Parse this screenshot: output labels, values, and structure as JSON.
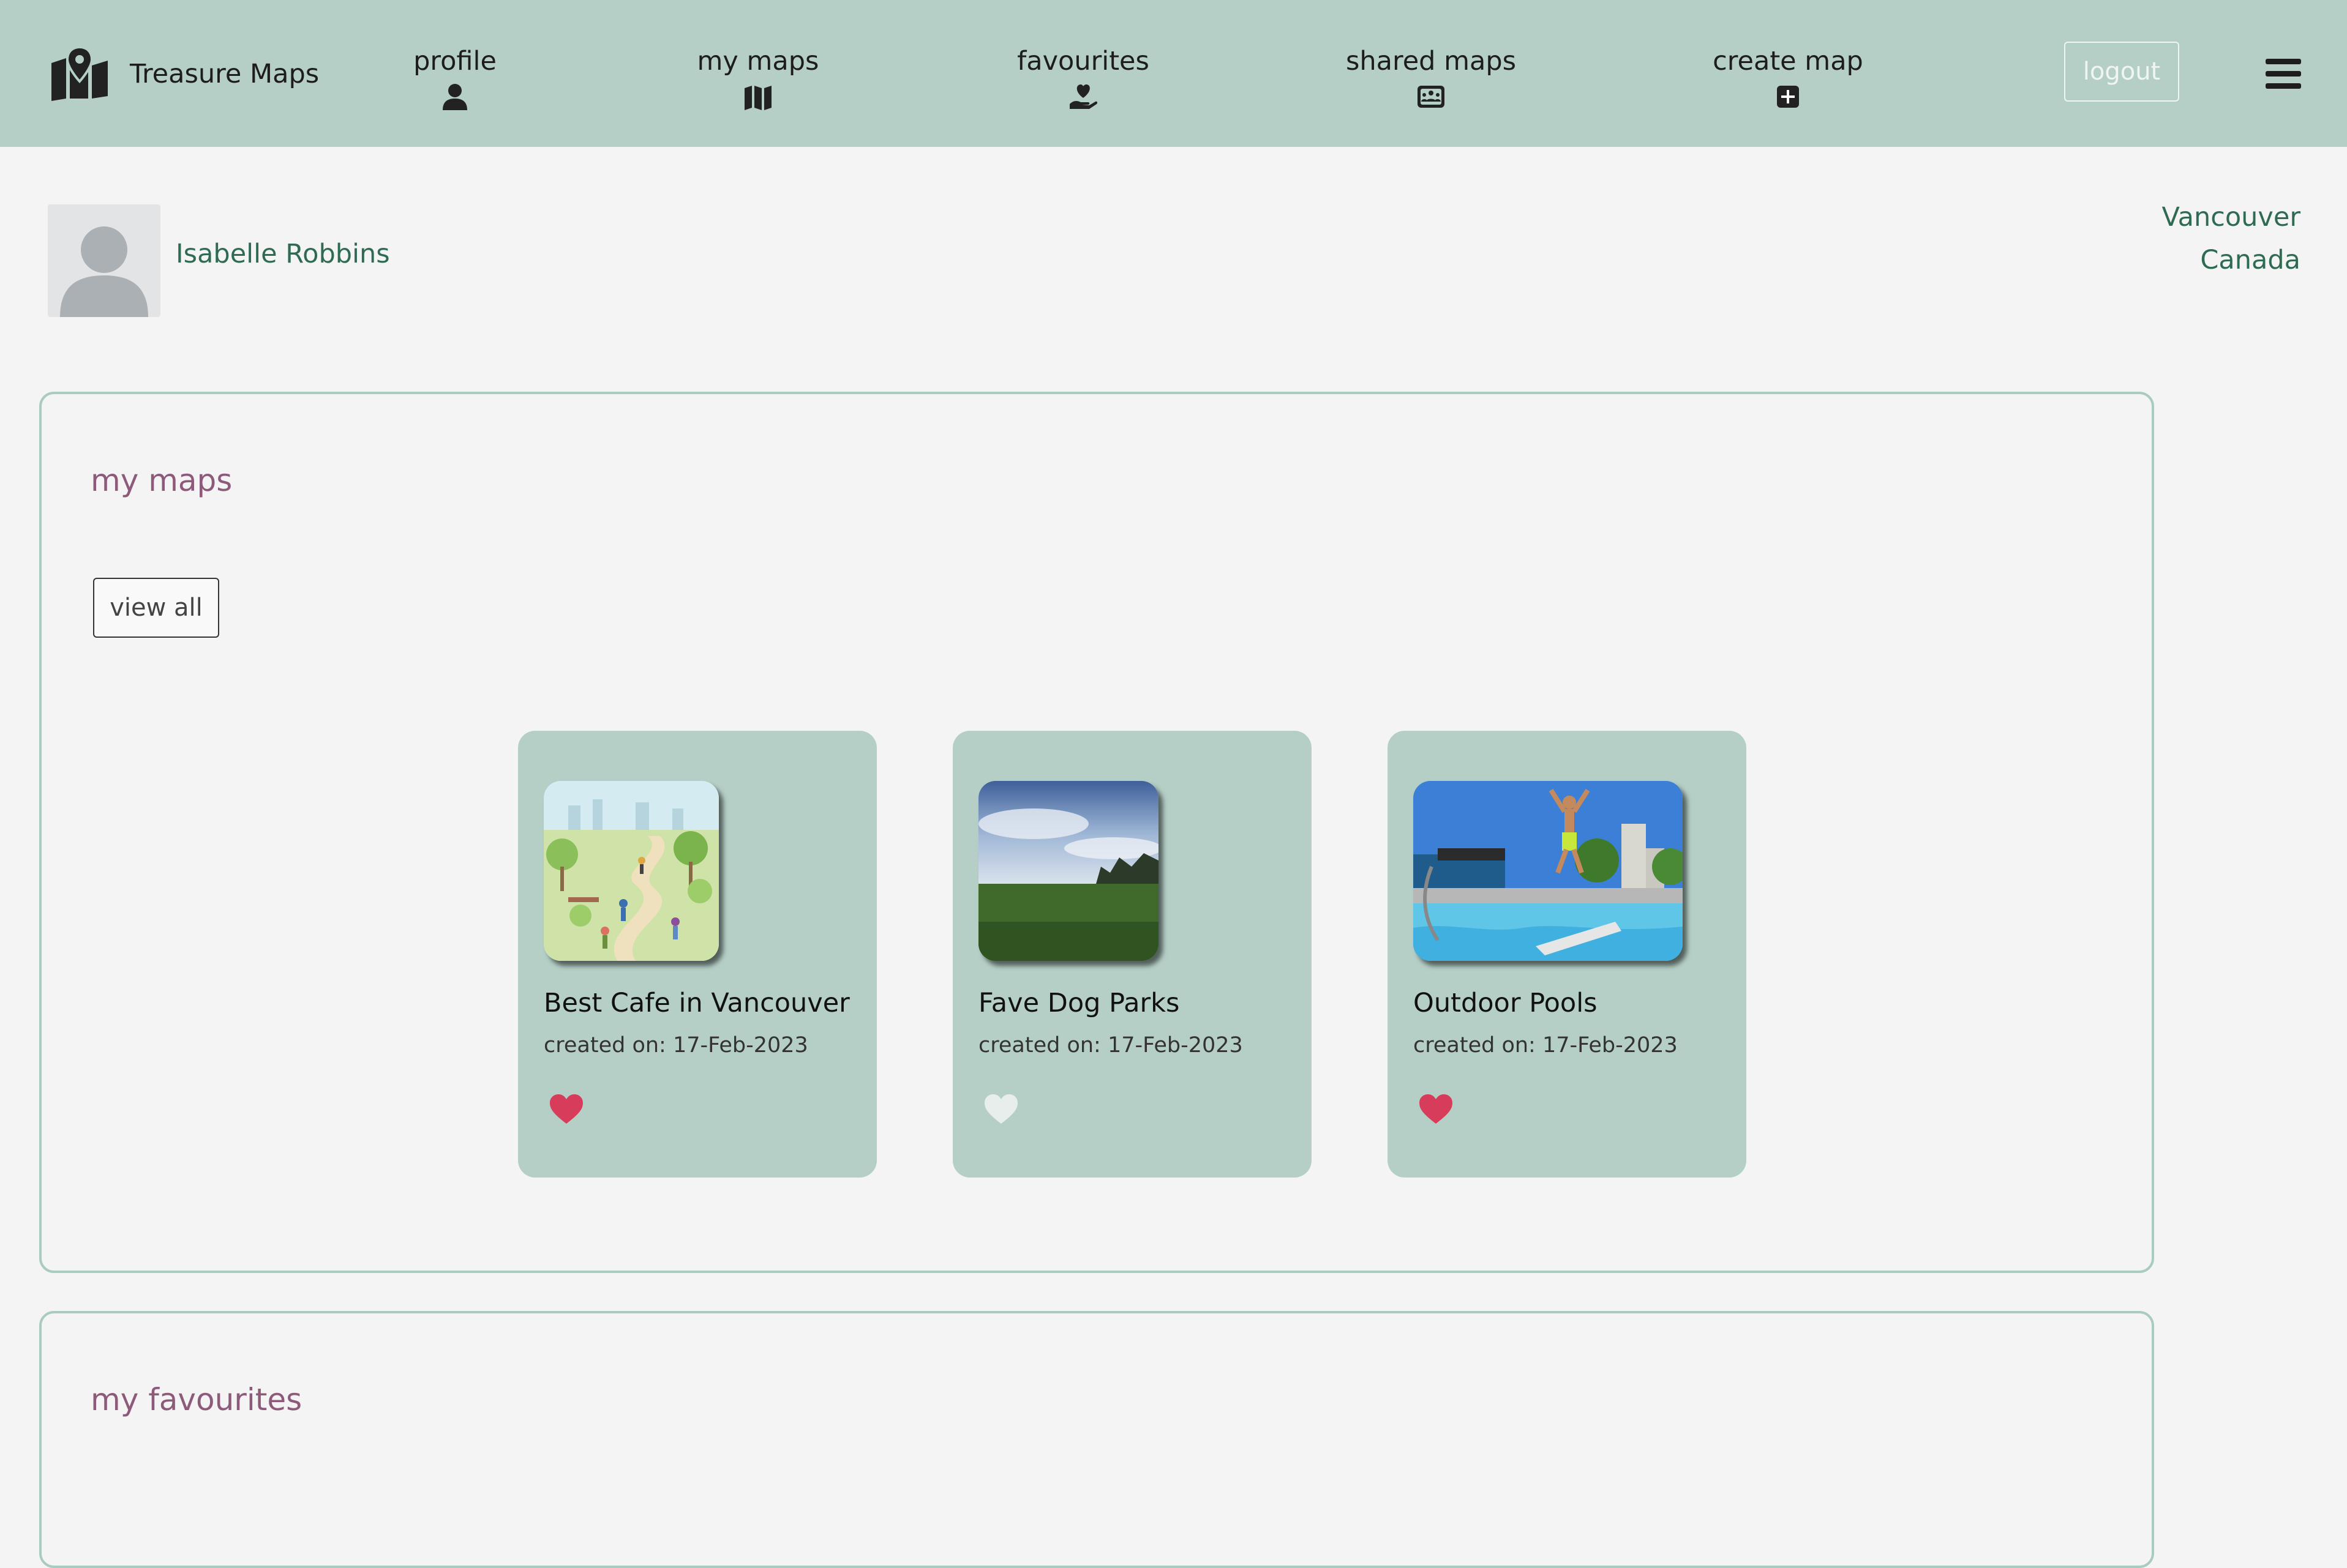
{
  "brand": {
    "name": "Treasure Maps",
    "icon": "map-pin-icon"
  },
  "nav": {
    "items": [
      {
        "label": "profile",
        "icon": "user-icon"
      },
      {
        "label": "my maps",
        "icon": "map-icon"
      },
      {
        "label": "favourites",
        "icon": "hand-heart-icon"
      },
      {
        "label": "shared maps",
        "icon": "users-rectangle-icon"
      },
      {
        "label": "create map",
        "icon": "plus-square-icon"
      }
    ],
    "logout_label": "logout",
    "menu_icon": "hamburger-icon"
  },
  "user": {
    "name": "Isabelle Robbins",
    "city": "Vancouver",
    "country": "Canada"
  },
  "my_maps": {
    "title": "my maps",
    "view_all_label": "view all",
    "cards": [
      {
        "title": "Best Cafe in Vancouver",
        "date": "created on: 17-Feb-2023",
        "favourited": true
      },
      {
        "title": "Fave Dog Parks",
        "date": "created on: 17-Feb-2023",
        "favourited": false
      },
      {
        "title": "Outdoor Pools",
        "date": "created on: 17-Feb-2023",
        "favourited": true
      }
    ]
  },
  "my_favourites": {
    "title": "my favourites"
  },
  "colors": {
    "navbar": "#b5cfc7",
    "card": "#b5cfc7",
    "panel_border": "#a9cbc1",
    "section_title": "#8d5a7a",
    "user_text": "#2f6b52",
    "heart_active": "#d83c5b",
    "heart_inactive": "#e8eeec"
  }
}
